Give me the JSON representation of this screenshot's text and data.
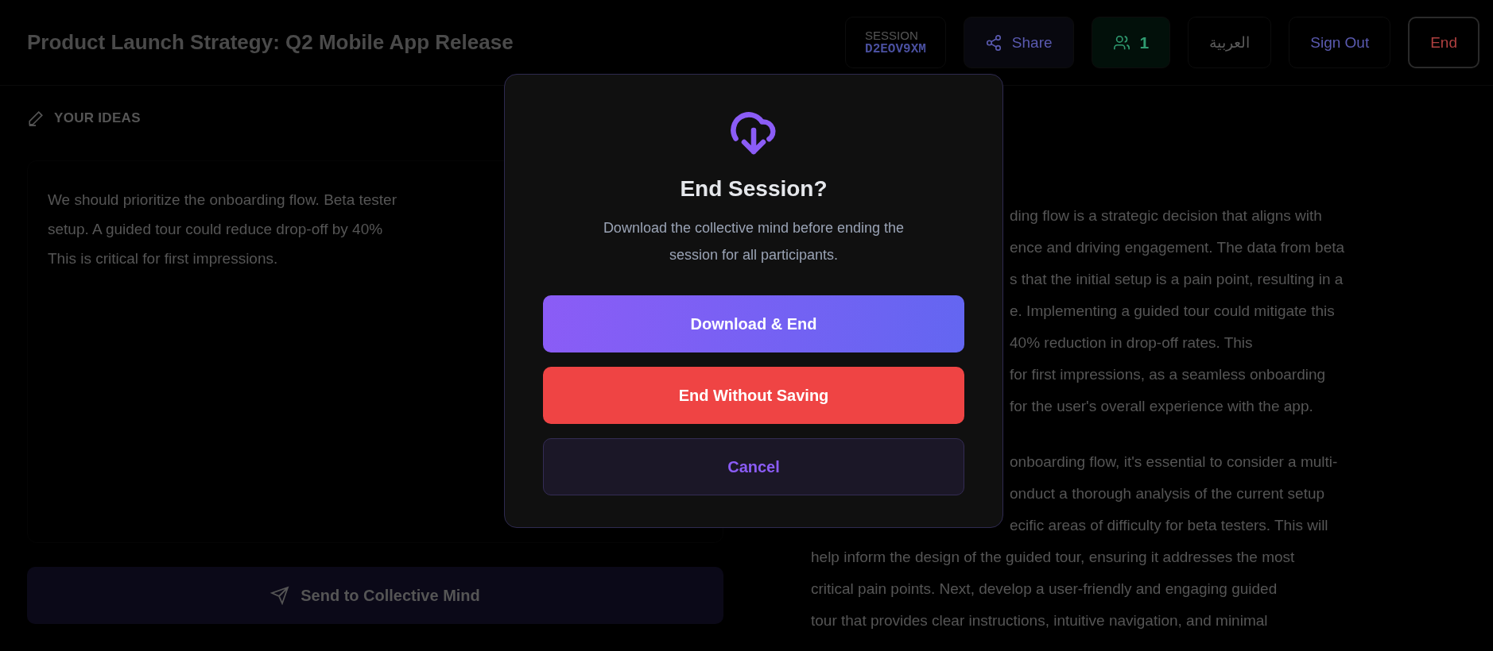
{
  "header": {
    "title": "Product Launch Strategy: Q2 Mobile App Release",
    "session": {
      "label": "SESSION",
      "code": "D2EOV9XM"
    },
    "buttons": [
      {
        "kind": "share",
        "label": "Share"
      },
      {
        "kind": "participants",
        "label": "1"
      },
      {
        "kind": "language",
        "label": "العربية"
      },
      {
        "kind": "signout",
        "label": "Sign Out"
      },
      {
        "kind": "end",
        "label": "End"
      }
    ]
  },
  "ideas": {
    "heading": "YOUR IDEAS",
    "lines": [
      "We should prioritize the onboarding flow. Beta tester",
      "setup. A guided tour could reduce drop-off by 40%",
      "This is critical for first impressions."
    ],
    "send_button": "Send to Collective Mind"
  },
  "response": {
    "paragraphs": [
      {
        "fragments": [
          "ding flow is a strategic decision that aligns with",
          "ence and driving engagement. The data from beta",
          "s that the initial setup is a pain point, resulting in a",
          "e. Implementing a guided tour could mitigate this",
          "40% reduction in drop-off rates. This",
          "for first impressions, as a seamless onboarding",
          "for the user's overall experience with the app."
        ]
      },
      {
        "fragments": [
          "onboarding flow, it's essential to consider a multi-",
          "onduct a thorough analysis of the current setup",
          "ecific areas of difficulty for beta testers. This will"
        ],
        "lines": [
          "help inform the design of the guided tour, ensuring it addresses the most",
          "critical pain points. Next, develop a user-friendly and engaging guided",
          "tour that provides clear instructions, intuitive navigation, and minimal"
        ]
      }
    ]
  },
  "dialog": {
    "title": "End Session?",
    "message": "Download the collective mind before ending the session for all participants.",
    "buttons": [
      {
        "kind": "primary",
        "label": "Download & End"
      },
      {
        "kind": "danger",
        "label": "End Without Saving"
      },
      {
        "kind": "secondary",
        "label": "Cancel"
      }
    ]
  }
}
